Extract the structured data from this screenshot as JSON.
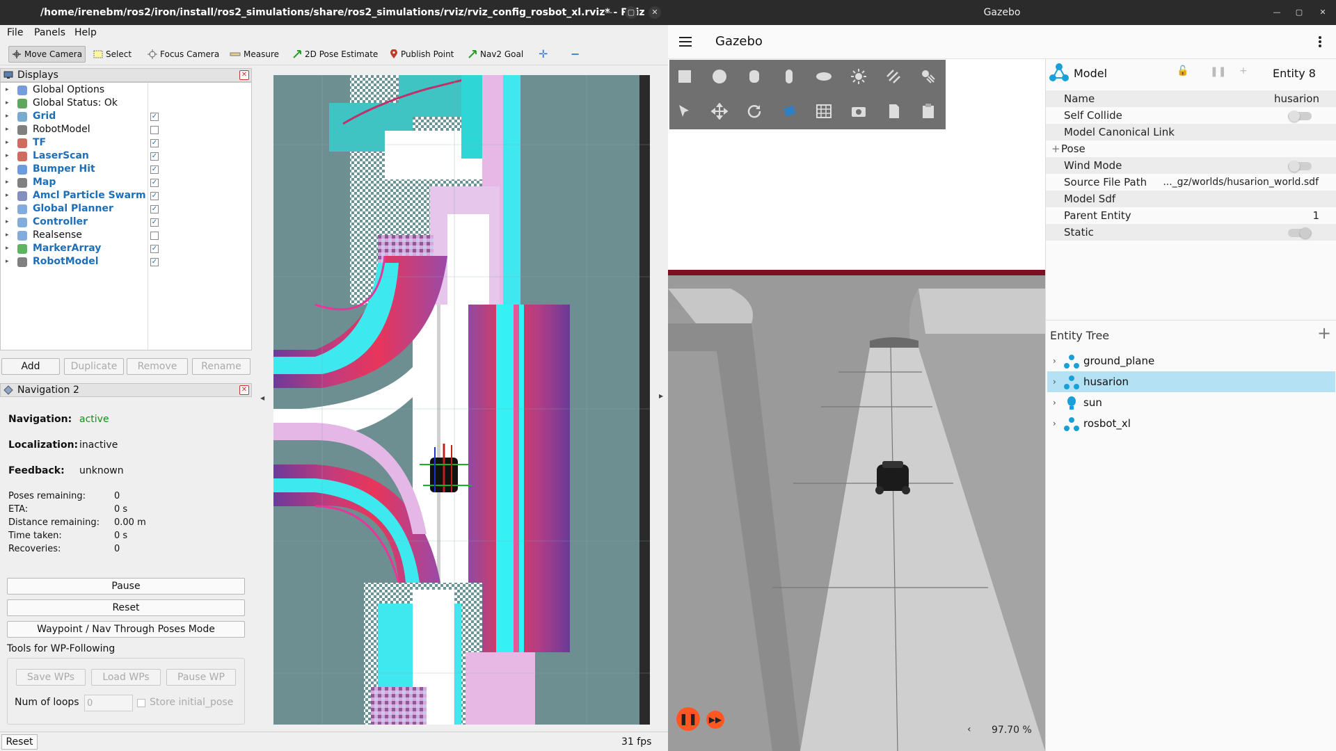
{
  "rviz": {
    "title": "/home/irenebm/ros2/iron/install/ros2_simulations/share/ros2_simulations/rviz/rviz_config_rosbot_xl.rviz* - RViz",
    "menu": [
      "File",
      "Panels",
      "Help"
    ],
    "toolbar": {
      "move_camera": "Move Camera",
      "select": "Select",
      "focus_camera": "Focus Camera",
      "measure": "Measure",
      "pose_estimate": "2D Pose Estimate",
      "publish_point": "Publish Point",
      "nav2_goal": "Nav2 Goal"
    },
    "displays": {
      "title": "Displays",
      "items": [
        {
          "label": "Global Options",
          "checked": null
        },
        {
          "label": "Global Status: Ok",
          "checked": null
        },
        {
          "label": "Grid",
          "checked": true
        },
        {
          "label": "RobotModel",
          "checked": false
        },
        {
          "label": "TF",
          "checked": true
        },
        {
          "label": "LaserScan",
          "checked": true
        },
        {
          "label": "Bumper Hit",
          "checked": true
        },
        {
          "label": "Map",
          "checked": true
        },
        {
          "label": "Amcl Particle Swarm",
          "checked": true
        },
        {
          "label": "Global Planner",
          "checked": true
        },
        {
          "label": "Controller",
          "checked": true
        },
        {
          "label": "Realsense",
          "checked": false
        },
        {
          "label": "MarkerArray",
          "checked": true
        },
        {
          "label": "RobotModel",
          "checked": true
        }
      ],
      "buttons": {
        "add": "Add",
        "duplicate": "Duplicate",
        "remove": "Remove",
        "rename": "Rename"
      }
    },
    "navigation": {
      "title": "Navigation 2",
      "navigation_label": "Navigation:",
      "navigation_value": "active",
      "localization_label": "Localization:",
      "localization_value": "inactive",
      "feedback_label": "Feedback:",
      "feedback_value": "unknown",
      "poses_remaining_label": "Poses remaining:",
      "poses_remaining_value": "0",
      "eta_label": "ETA:",
      "eta_value": "0 s",
      "distance_label": "Distance remaining:",
      "distance_value": "0.00 m",
      "time_taken_label": "Time taken:",
      "time_taken_value": "0 s",
      "recoveries_label": "Recoveries:",
      "recoveries_value": "0",
      "pause_button": "Pause",
      "reset_button": "Reset",
      "waypoint_button": "Waypoint / Nav Through Poses Mode",
      "wp_group_title": "Tools for WP-Following",
      "save_wps": "Save WPs",
      "load_wps": "Load WPs",
      "pause_wp": "Pause WP",
      "num_loops_label": "Num of loops",
      "num_loops_value": "0",
      "store_initial_pose": "Store initial_pose"
    },
    "status": {
      "reset": "Reset",
      "fps": "31 fps"
    }
  },
  "gazebo": {
    "title": "Gazebo",
    "app_title": "Gazebo",
    "component": {
      "label": "Model",
      "entity": "Entity 8",
      "rows": [
        {
          "key": "Name",
          "value": "husarion"
        },
        {
          "key": "Self Collide",
          "value": ""
        },
        {
          "key": "Model Canonical Link",
          "value": ""
        },
        {
          "key": "Pose",
          "value": ""
        },
        {
          "key": "Wind Mode",
          "value": ""
        },
        {
          "key": "Source File Path",
          "value": "..._gz/worlds/husarion_world.sdf"
        },
        {
          "key": "Model Sdf",
          "value": ""
        },
        {
          "key": "Parent Entity",
          "value": "1"
        },
        {
          "key": "Static",
          "value": ""
        }
      ]
    },
    "entity_tree": {
      "title": "Entity Tree",
      "items": [
        "ground_plane",
        "husarion",
        "sun",
        "rosbot_xl"
      ],
      "selected": "husarion"
    },
    "rtf": "97.70 %"
  }
}
